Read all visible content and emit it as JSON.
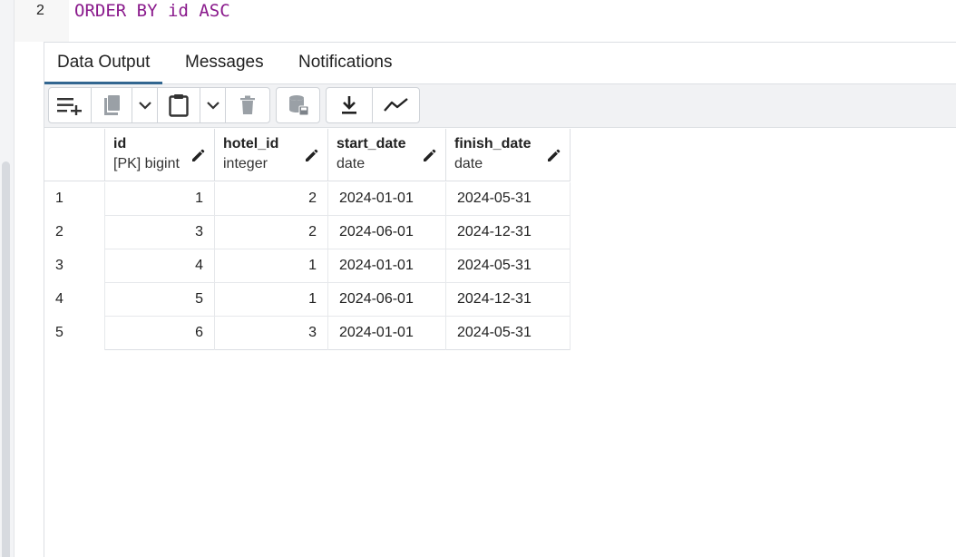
{
  "editor": {
    "line_number": "2",
    "code": {
      "kw_order": "ORDER",
      "kw_by": "BY",
      "ident": "id",
      "kw_asc": "ASC"
    }
  },
  "tabs": [
    {
      "label": "Data Output",
      "active": true
    },
    {
      "label": "Messages",
      "active": false
    },
    {
      "label": "Notifications",
      "active": false
    }
  ],
  "toolbar": {
    "icons": [
      "add-row-icon",
      "copy-icon",
      "chevron-down-icon",
      "paste-icon",
      "chevron-down-icon",
      "delete-icon",
      "save-data-icon",
      "download-icon",
      "graph-visualiser-icon"
    ]
  },
  "grid": {
    "columns": [
      {
        "name": "id",
        "type": "[PK] bigint"
      },
      {
        "name": "hotel_id",
        "type": "integer"
      },
      {
        "name": "start_date",
        "type": "date"
      },
      {
        "name": "finish_date",
        "type": "date"
      }
    ],
    "rows": [
      {
        "n": "1",
        "id": "1",
        "hotel_id": "2",
        "start_date": "2024-01-01",
        "finish_date": "2024-05-31"
      },
      {
        "n": "2",
        "id": "3",
        "hotel_id": "2",
        "start_date": "2024-06-01",
        "finish_date": "2024-12-31"
      },
      {
        "n": "3",
        "id": "4",
        "hotel_id": "1",
        "start_date": "2024-01-01",
        "finish_date": "2024-05-31"
      },
      {
        "n": "4",
        "id": "5",
        "hotel_id": "1",
        "start_date": "2024-06-01",
        "finish_date": "2024-12-31"
      },
      {
        "n": "5",
        "id": "6",
        "hotel_id": "3",
        "start_date": "2024-01-01",
        "finish_date": "2024-05-31"
      }
    ]
  },
  "colors": {
    "accent": "#326690",
    "keyword": "#8a1a8c"
  }
}
